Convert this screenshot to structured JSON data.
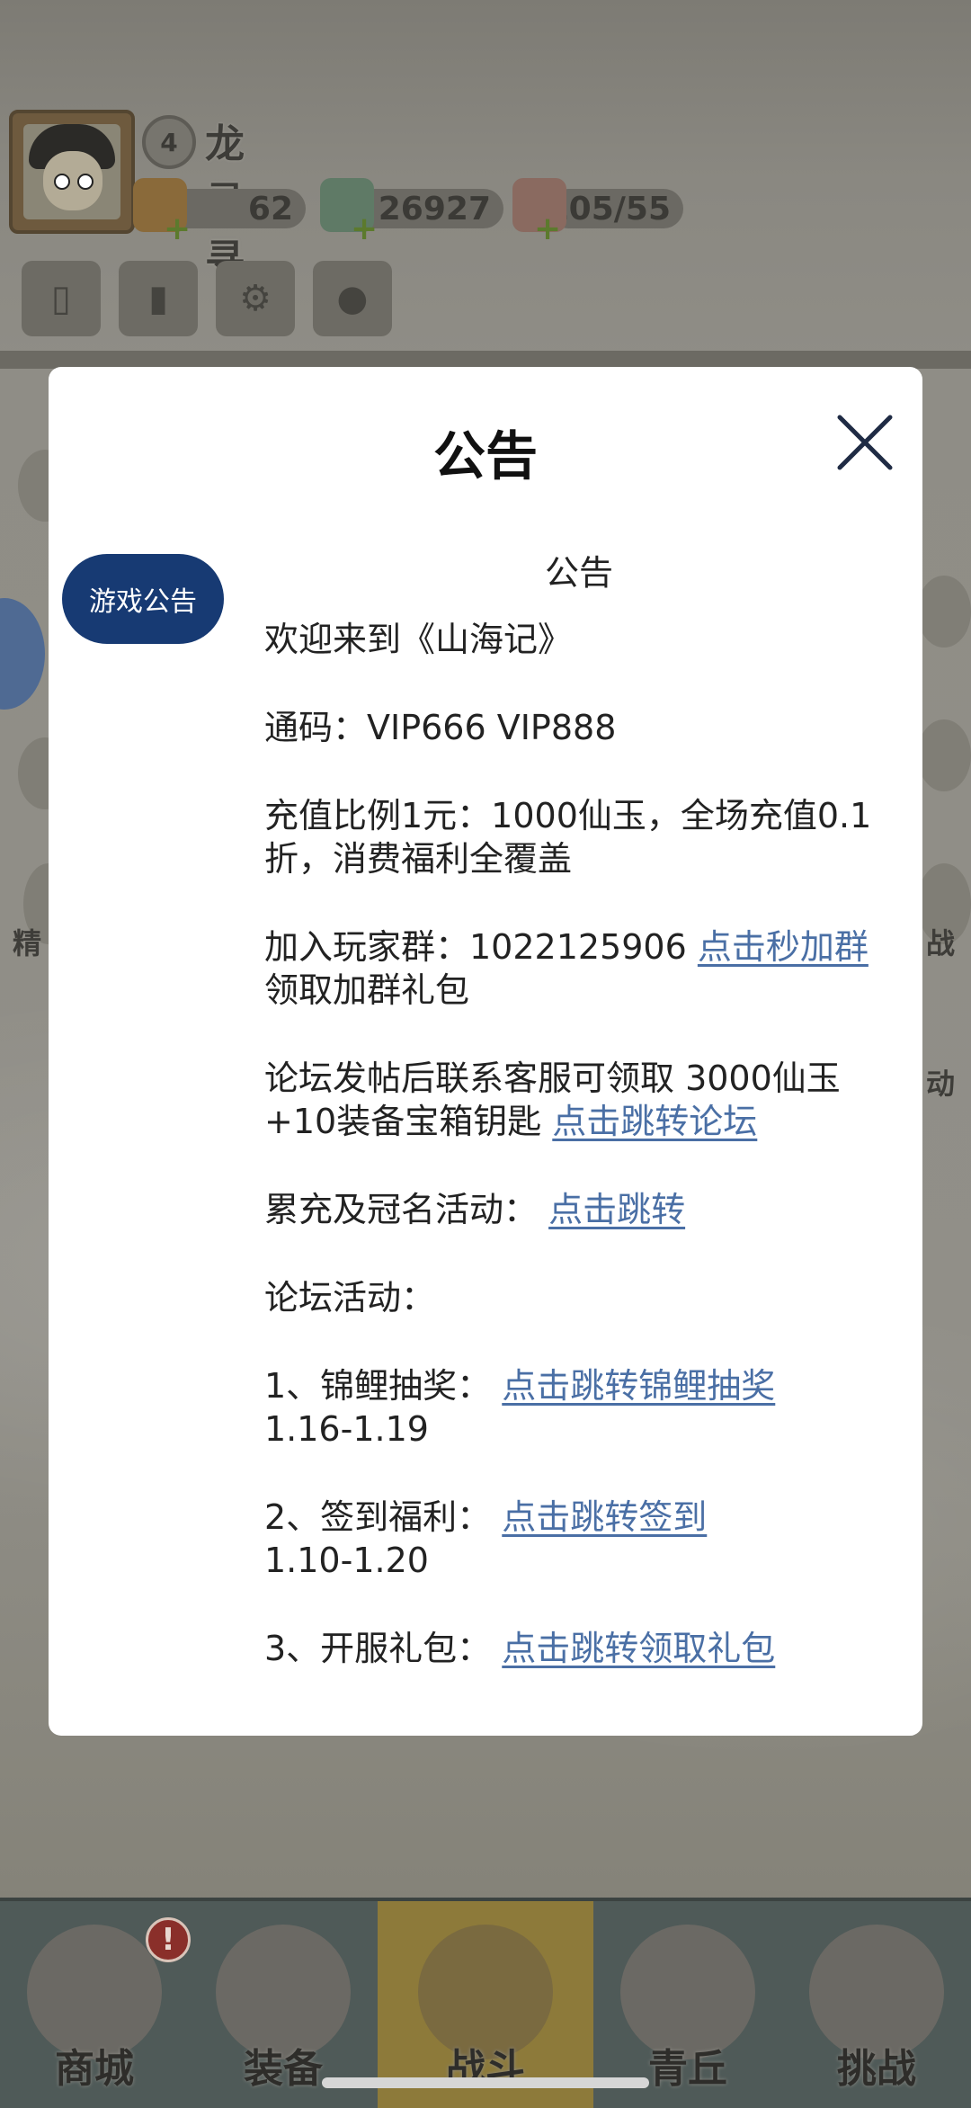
{
  "background": {
    "player": {
      "name": "龙寻寻",
      "level": "4"
    },
    "stats": [
      {
        "name": "tokens",
        "value": "62"
      },
      {
        "name": "jade",
        "value": "26927"
      },
      {
        "name": "stamina",
        "value": "105/55"
      }
    ],
    "side_labels": {
      "left": "精",
      "right": "战",
      "right_bottom": "动"
    },
    "bottom_nav": [
      {
        "label": "商城",
        "icon": "shop-icon"
      },
      {
        "label": "装备",
        "icon": "armor-icon"
      },
      {
        "label": "战斗",
        "icon": "crossed-swords-icon",
        "active": true
      },
      {
        "label": "青丘",
        "icon": "mountain-icon"
      },
      {
        "label": "挑战",
        "icon": "challenge-icon"
      }
    ],
    "shop_badge": "!"
  },
  "modal": {
    "title": "公告",
    "close_icon": "close-icon",
    "tab_label": "游戏公告",
    "content": {
      "heading": "公告",
      "welcome": "欢迎来到《山海记》",
      "codes": "通码：VIP666 VIP888",
      "recharge": "充值比例1元：1000仙玉，全场充值0.1折，消费福利全覆盖",
      "group_text": "加入玩家群：1022125906 ",
      "group_link": "点击秒加群",
      "group_suffix": " 领取加群礼包",
      "forum_text": "论坛发帖后联系客服可领取 3000仙玉+10装备宝箱钥匙 ",
      "forum_link": "点击跳转论坛",
      "ranking_text": "累充及冠名活动：  ",
      "ranking_link": "点击跳转",
      "forum_events": "论坛活动：",
      "event1_text": "1、锦鲤抽奖：  ",
      "event1_link": "点击跳转锦鲤抽奖",
      "event1_date": "1.16-1.19",
      "event2_text": "2、签到福利：  ",
      "event2_link": "点击跳转签到",
      "event2_date": "1.10-1.20",
      "event3_text": "3、开服礼包：  ",
      "event3_link": "点击跳转领取礼包"
    }
  },
  "colors": {
    "tab_pill": "#173a73",
    "link": "#4a6fa5",
    "overlay": "#8f8d86"
  }
}
